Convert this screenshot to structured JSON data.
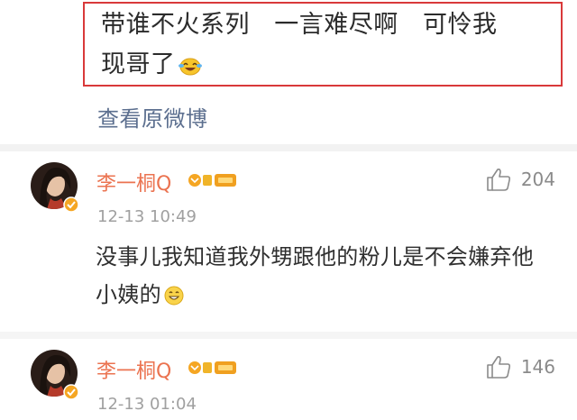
{
  "post": {
    "text_line1": "带谁不火系列   一言难尽啊   可怜我",
    "text_line2": "现哥了",
    "emoji": "laugh-cry-emoji",
    "view_original": "查看原微博",
    "highlight_color": "#d9393a"
  },
  "comments": [
    {
      "username": "李一桐Q",
      "timestamp": "12-13 10:49",
      "like_count": "204",
      "text": "没事儿我知道我外甥跟他的粉儿是不会嫌弃他小姨的",
      "emoji": "grin-emoji"
    },
    {
      "username": "李一桐Q",
      "timestamp": "12-13 01:04",
      "like_count": "146"
    }
  ],
  "colors": {
    "username": "#eb7350",
    "link": "#5c6f8f",
    "meta": "#a0a0a0",
    "divider": "#f2f2f2"
  }
}
